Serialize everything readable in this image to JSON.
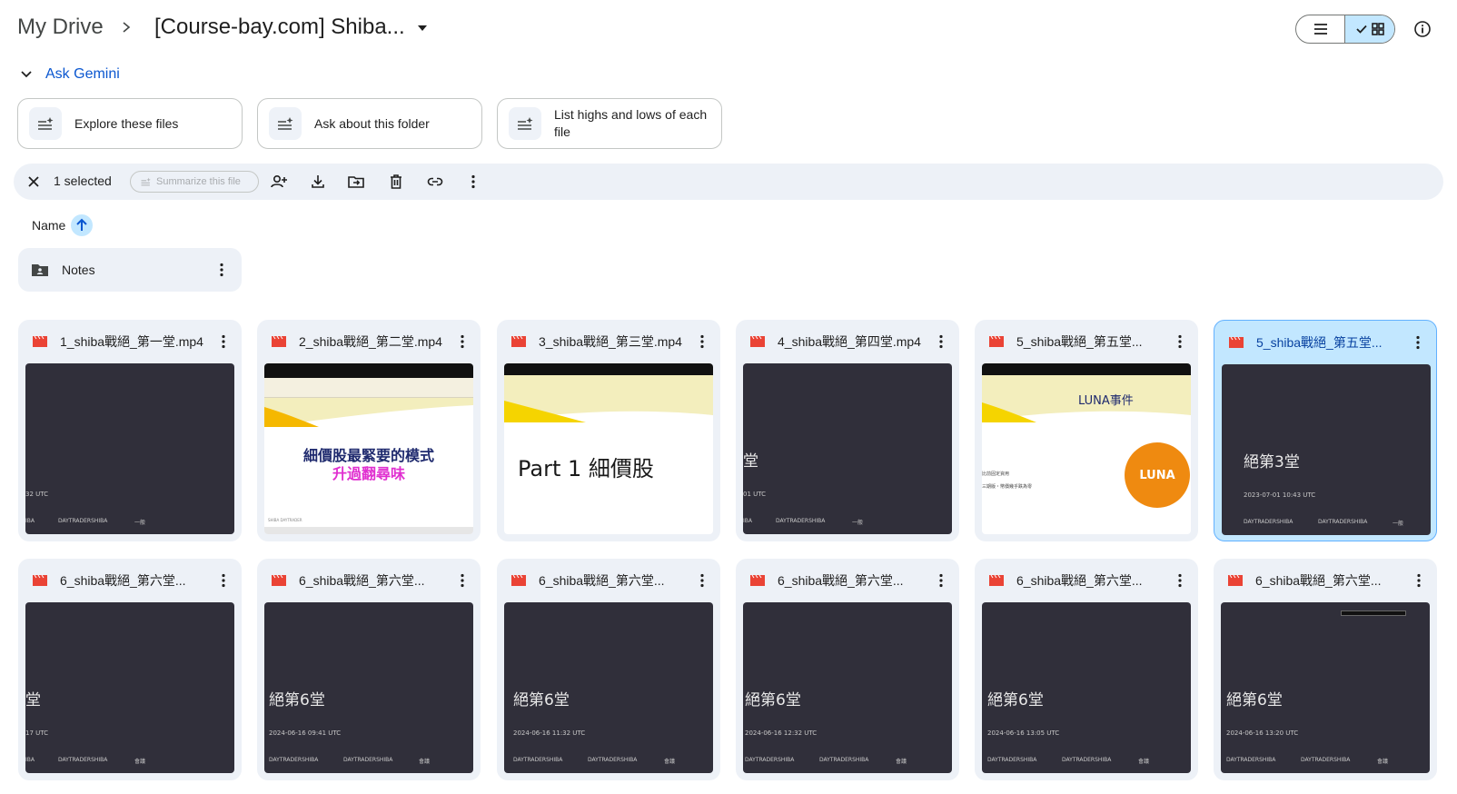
{
  "breadcrumb": {
    "root": "My Drive",
    "current": "[Course-bay.com] Shiba..."
  },
  "gemini": {
    "label": "Ask Gemini",
    "chips": [
      {
        "label": "Explore these files"
      },
      {
        "label": "Ask about this folder"
      },
      {
        "label": "List highs and lows of each file"
      }
    ]
  },
  "selection": {
    "count_label": "1 selected",
    "summarize_label": "Summarize this file"
  },
  "sort": {
    "label": "Name"
  },
  "folder": {
    "name": "Notes"
  },
  "files": [
    {
      "name": "1_shiba戰絕_第一堂.mp4",
      "thumb_big": "堂",
      "thumb_time": "32 UTC",
      "thumb_foot": "IBA",
      "thumb_org": "DAYTRADERSHIBA",
      "thumb_channel": "一般"
    },
    {
      "name": "2_shiba戰絕_第二堂.mp4",
      "slide_line1": "細價股最緊要的模式",
      "slide_line2": "升過翻尋味",
      "slide_foot": "SHIBA DAYTRADER"
    },
    {
      "name": "3_shiba戰絕_第三堂.mp4",
      "slide_title": "Part 1 細價股"
    },
    {
      "name": "4_shiba戰絕_第四堂.mp4",
      "thumb_big": "堂",
      "thumb_time": "01 UTC",
      "thumb_foot": "IBA",
      "thumb_org": "DAYTRADERSHIBA",
      "thumb_channel": "一般"
    },
    {
      "name": "5_shiba戰絕_第五堂...",
      "slide_title": "LUNA事件",
      "slide_badge": "LUNA",
      "slide_note1": "比前固定資用",
      "slide_note2": "三期版・幣價幾乎跌為零"
    },
    {
      "name": "5_shiba戰絕_第五堂...",
      "thumb_big": "絕第3堂",
      "thumb_time": "2023-07-01 10:43 UTC",
      "thumb_rec": "DAYTRADERSHIBA",
      "thumb_org": "DAYTRADERSHIBA",
      "thumb_channel": "一般"
    },
    {
      "name": "6_shiba戰絕_第六堂...",
      "thumb_big": "堂",
      "thumb_time": "17 UTC",
      "thumb_foot": "IBA",
      "thumb_org": "DAYTRADERSHIBA",
      "thumb_channel": "會議"
    },
    {
      "name": "6_shiba戰絕_第六堂...",
      "thumb_big": "絕第6堂",
      "thumb_time": "2024-06-16 09:41 UTC",
      "thumb_rec": "DAYTRADERSHIBA",
      "thumb_org": "DAYTRADERSHIBA",
      "thumb_channel": "會議"
    },
    {
      "name": "6_shiba戰絕_第六堂...",
      "thumb_big": "絕第6堂",
      "thumb_time": "2024-06-16 11:32 UTC",
      "thumb_rec": "DAYTRADERSHIBA",
      "thumb_org": "DAYTRADERSHIBA",
      "thumb_channel": "會議"
    },
    {
      "name": "6_shiba戰絕_第六堂...",
      "thumb_big": "絕第6堂",
      "thumb_time": "2024-06-16 12:32 UTC",
      "thumb_rec": "DAYTRADERSHIBA",
      "thumb_org": "DAYTRADERSHIBA",
      "thumb_channel": "會議"
    },
    {
      "name": "6_shiba戰絕_第六堂...",
      "thumb_big": "絕第6堂",
      "thumb_time": "2024-06-16 13:05 UTC",
      "thumb_rec": "DAYTRADERSHIBA",
      "thumb_org": "DAYTRADERSHIBA",
      "thumb_channel": "會議"
    },
    {
      "name": "6_shiba戰絕_第六堂...",
      "thumb_big": "絕第6堂",
      "thumb_time": "2024-06-16 13:20 UTC",
      "thumb_rec": "DAYTRADERSHIBA",
      "thumb_org": "DAYTRADERSHIBA",
      "thumb_channel": "會議"
    }
  ],
  "colors": {
    "accent_blue": "#0b57d0",
    "selected_bg": "#c2e7ff",
    "surface": "#edf1f7",
    "video_red": "#ea4335",
    "thumb_dark": "#302f3a"
  }
}
